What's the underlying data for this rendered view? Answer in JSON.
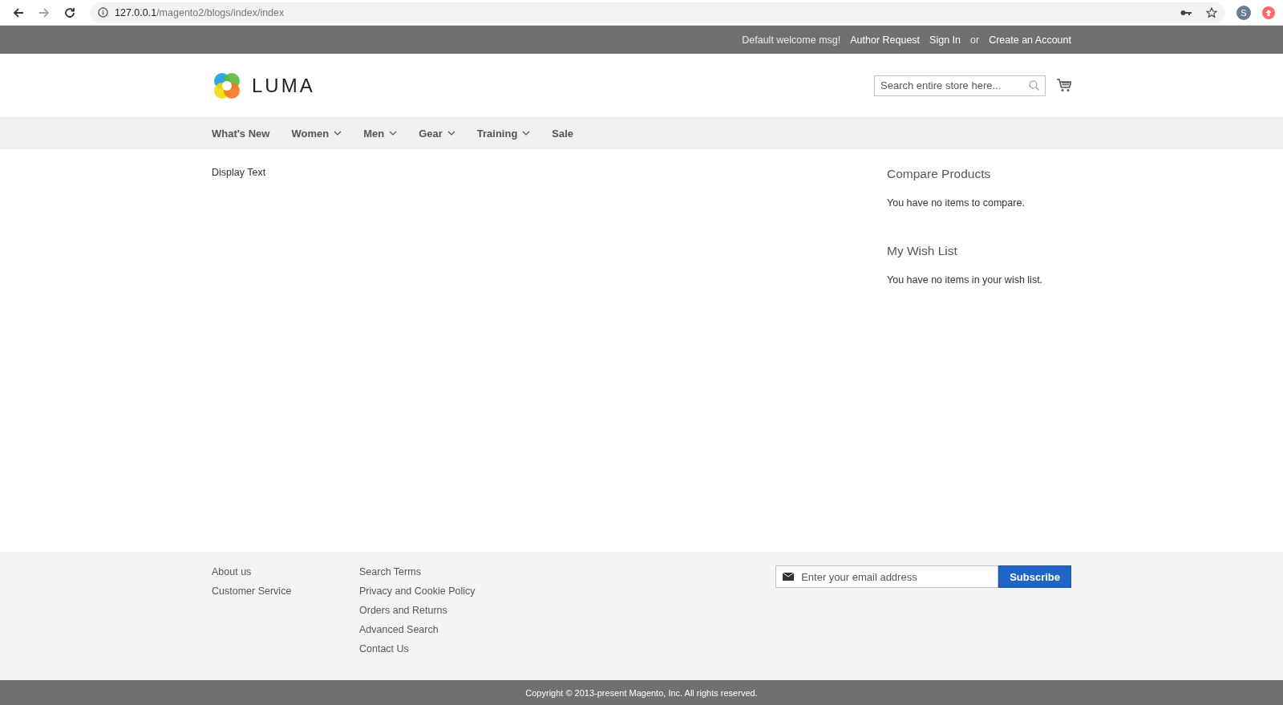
{
  "browser": {
    "url_host": "127.0.0.1",
    "url_path": "/magento2/blogs/index/index",
    "profile_initial": "S"
  },
  "top_links": [
    {
      "text": "Default welcome msg!",
      "kind": "text"
    },
    {
      "text": "Author Request",
      "kind": "link"
    },
    {
      "text": "Sign In",
      "kind": "link"
    },
    {
      "text": "or",
      "kind": "text"
    },
    {
      "text": "Create an Account",
      "kind": "link"
    }
  ],
  "header": {
    "logo_text": "LUMA",
    "search": {
      "placeholder": "Search entire store here..."
    }
  },
  "nav": [
    {
      "label": "What's New",
      "has_submenu": false
    },
    {
      "label": "Women",
      "has_submenu": true
    },
    {
      "label": "Men",
      "has_submenu": true
    },
    {
      "label": "Gear",
      "has_submenu": true
    },
    {
      "label": "Training",
      "has_submenu": true
    },
    {
      "label": "Sale",
      "has_submenu": false
    }
  ],
  "main": {
    "text": "Display Text"
  },
  "sidebar": [
    {
      "title": "Compare Products",
      "text": "You have no items to compare."
    },
    {
      "title": "My Wish List",
      "text": "You have no items in your wish list."
    }
  ],
  "footer": {
    "columns": [
      [
        "About us",
        "Customer Service"
      ],
      [
        "Search Terms",
        "Privacy and Cookie Policy",
        "Orders and Returns",
        "Advanced Search",
        "Contact Us"
      ]
    ],
    "newsletter": {
      "placeholder": "Enter your email address",
      "button": "Subscribe"
    },
    "copyright": "Copyright © 2013-present Magento, Inc. All rights reserved."
  }
}
